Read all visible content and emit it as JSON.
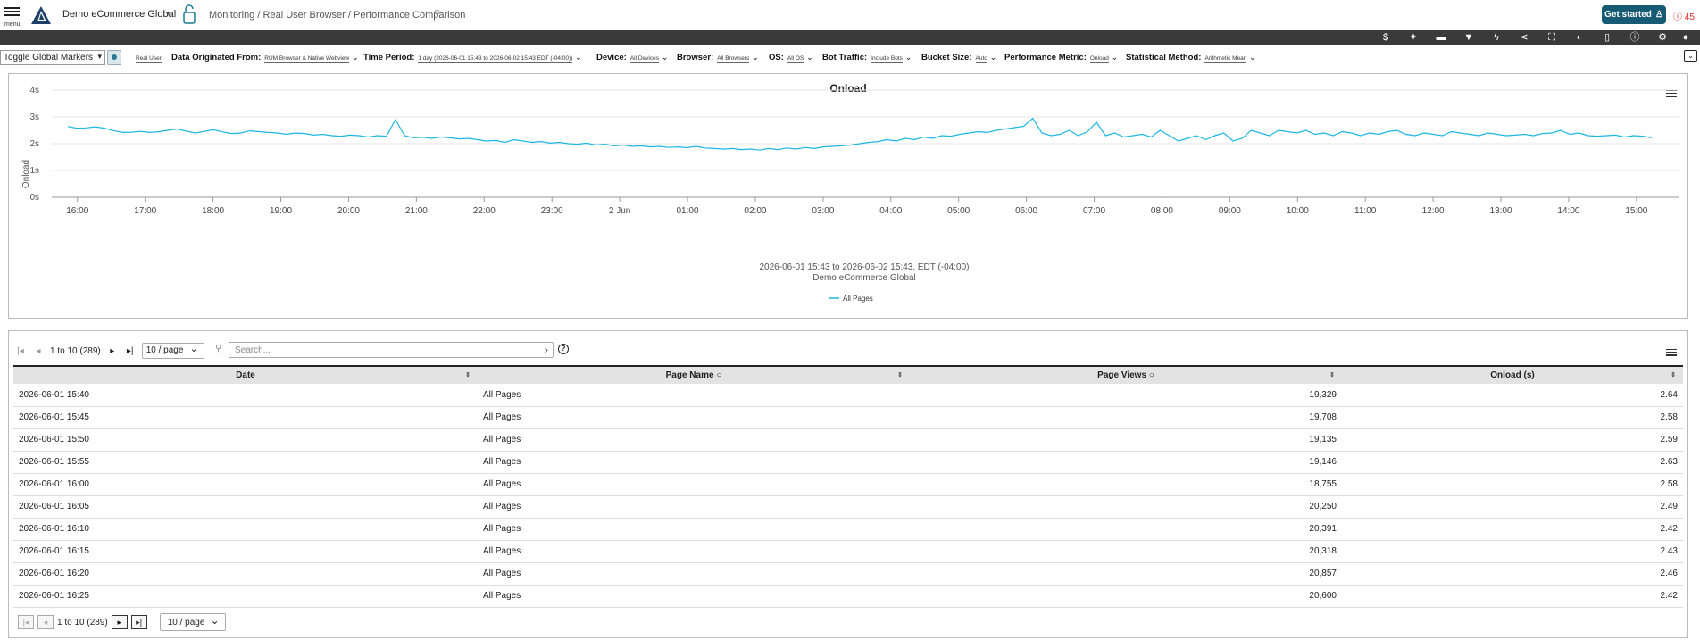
{
  "header": {
    "menu_label": "menu",
    "org_name": "Demo eCommerce Global",
    "breadcrumb": "Monitoring / Real User Browser / Performance Comparison",
    "get_started": "Get started",
    "alert_count": "45"
  },
  "toolbar_icons": [
    "dollar-icon",
    "sparkle-icon",
    "comment-icon",
    "filter-icon",
    "lightning-icon",
    "share-icon",
    "fullscreen-icon",
    "contrast-icon",
    "info-icon",
    "help-icon",
    "gear-icon",
    "user-icon"
  ],
  "filters": {
    "toggle_markers": "Toggle Global Markers",
    "real_user": "Real User",
    "items": [
      {
        "label": "Data Originated From:",
        "value": "RUM Browser & Native Webview"
      },
      {
        "label": "Time Period:",
        "value": "1 day (2026-06-01 15:43 to 2026-06-02 15:43 EDT (-04:00))"
      },
      {
        "label": "Device:",
        "value": "All Devices"
      },
      {
        "label": "Browser:",
        "value": "All Browsers"
      },
      {
        "label": "OS:",
        "value": "All OS"
      },
      {
        "label": "Bot Traffic:",
        "value": "Include Bots"
      },
      {
        "label": "Bucket Size:",
        "value": "Auto"
      },
      {
        "label": "Performance Metric:",
        "value": "Onload"
      },
      {
        "label": "Statistical Method:",
        "value": "Arithmetic Mean"
      }
    ]
  },
  "chart_data": {
    "type": "line",
    "title": "Onload",
    "ylabel": "Onload",
    "ylim": [
      0,
      4
    ],
    "yticks": [
      "0s",
      "1s",
      "2s",
      "3s",
      "4s"
    ],
    "x_tick_labels": [
      "16:00",
      "17:00",
      "18:00",
      "19:00",
      "20:00",
      "21:00",
      "22:00",
      "23:00",
      "2 Jun",
      "01:00",
      "02:00",
      "03:00",
      "04:00",
      "05:00",
      "06:00",
      "07:00",
      "08:00",
      "09:00",
      "10:00",
      "11:00",
      "12:00",
      "13:00",
      "14:00",
      "15:00"
    ],
    "x_start_hour": 15.7,
    "subtitle": "2026-06-01 15:43 to 2026-06-02 15:43, EDT (-04:00)",
    "subtitle2": "Demo eCommerce Global",
    "grid": true,
    "legend_position": "bottom-center",
    "series": [
      {
        "name": "All Pages",
        "color": "#1bb6e6",
        "values": [
          2.64,
          2.58,
          2.59,
          2.63,
          2.58,
          2.49,
          2.42,
          2.43,
          2.46,
          2.42,
          2.45,
          2.5,
          2.55,
          2.47,
          2.4,
          2.46,
          2.52,
          2.44,
          2.38,
          2.4,
          2.48,
          2.45,
          2.42,
          2.4,
          2.35,
          2.4,
          2.38,
          2.32,
          2.35,
          2.3,
          2.28,
          2.32,
          2.3,
          2.25,
          2.3,
          2.28,
          2.9,
          2.3,
          2.22,
          2.24,
          2.2,
          2.25,
          2.22,
          2.18,
          2.2,
          2.15,
          2.1,
          2.12,
          2.05,
          2.15,
          2.1,
          2.05,
          2.08,
          2.02,
          2.05,
          2.0,
          1.98,
          2.02,
          1.95,
          1.98,
          1.92,
          1.95,
          1.9,
          1.92,
          1.88,
          1.9,
          1.86,
          1.88,
          1.85,
          1.9,
          1.84,
          1.82,
          1.8,
          1.82,
          1.78,
          1.8,
          1.76,
          1.82,
          1.78,
          1.84,
          1.8,
          1.86,
          1.82,
          1.88,
          1.9,
          1.92,
          1.95,
          2.0,
          2.05,
          2.08,
          2.15,
          2.1,
          2.2,
          2.15,
          2.25,
          2.2,
          2.3,
          2.28,
          2.35,
          2.4,
          2.45,
          2.42,
          2.5,
          2.55,
          2.6,
          2.65,
          2.95,
          2.4,
          2.3,
          2.35,
          2.5,
          2.3,
          2.45,
          2.8,
          2.3,
          2.4,
          2.25,
          2.3,
          2.35,
          2.25,
          2.5,
          2.3,
          2.1,
          2.2,
          2.3,
          2.15,
          2.3,
          2.4,
          2.1,
          2.2,
          2.5,
          2.4,
          2.3,
          2.5,
          2.45,
          2.4,
          2.5,
          2.35,
          2.4,
          2.3,
          2.45,
          2.4,
          2.3,
          2.4,
          2.35,
          2.45,
          2.5,
          2.35,
          2.3,
          2.4,
          2.35,
          2.3,
          2.45,
          2.4,
          2.35,
          2.3,
          2.4,
          2.35,
          2.3,
          2.32,
          2.35,
          2.3,
          2.38,
          2.4,
          2.5,
          2.35,
          2.4,
          2.3,
          2.28,
          2.3,
          2.32,
          2.25,
          2.3,
          2.28,
          2.22
        ]
      }
    ]
  },
  "table": {
    "pager_text": "1 to 10 (289)",
    "per_page": "10 / page",
    "search_placeholder": "Search...",
    "columns": [
      "Date",
      "Page Name",
      "Page Views",
      "Onload (s)"
    ],
    "rows": [
      [
        "2026-06-01 15:40",
        "All Pages",
        "19,329",
        "2.64"
      ],
      [
        "2026-06-01 15:45",
        "All Pages",
        "19,708",
        "2.58"
      ],
      [
        "2026-06-01 15:50",
        "All Pages",
        "19,135",
        "2.59"
      ],
      [
        "2026-06-01 15:55",
        "All Pages",
        "19,146",
        "2.63"
      ],
      [
        "2026-06-01 16:00",
        "All Pages",
        "18,755",
        "2.58"
      ],
      [
        "2026-06-01 16:05",
        "All Pages",
        "20,250",
        "2.49"
      ],
      [
        "2026-06-01 16:10",
        "All Pages",
        "20,391",
        "2.42"
      ],
      [
        "2026-06-01 16:15",
        "All Pages",
        "20,318",
        "2.43"
      ],
      [
        "2026-06-01 16:20",
        "All Pages",
        "20,857",
        "2.46"
      ],
      [
        "2026-06-01 16:25",
        "All Pages",
        "20,600",
        "2.42"
      ]
    ]
  }
}
